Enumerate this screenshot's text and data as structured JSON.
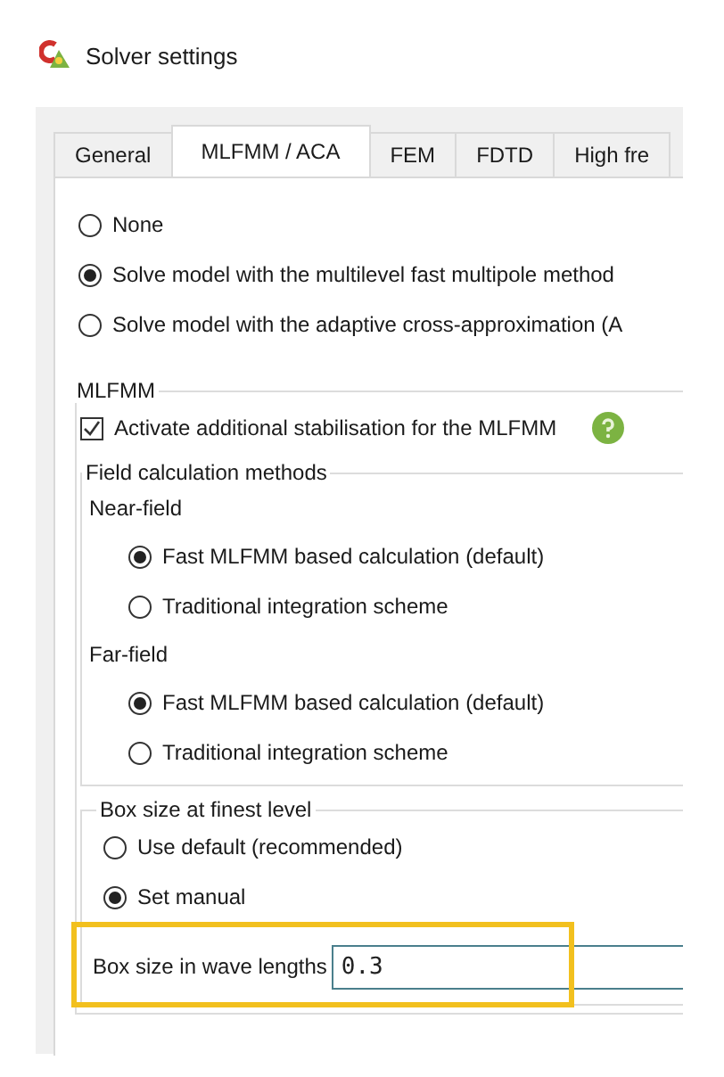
{
  "window": {
    "title": "Solver settings"
  },
  "tabs": [
    {
      "label": "General",
      "selected": false
    },
    {
      "label": "MLFMM / ACA",
      "selected": true
    },
    {
      "label": "FEM",
      "selected": false
    },
    {
      "label": "FDTD",
      "selected": false
    },
    {
      "label": "High fre",
      "selected": false
    }
  ],
  "solver_options": [
    {
      "label": "None",
      "selected": false
    },
    {
      "label": "Solve model with the multilevel fast multipole method",
      "selected": true
    },
    {
      "label": "Solve model with the adaptive cross-approximation (A",
      "selected": false
    }
  ],
  "mlfmm": {
    "title": "MLFMM",
    "stabilisation": {
      "label": "Activate additional stabilisation for the MLFMM",
      "checked": true
    },
    "field_calculation": {
      "title": "Field calculation methods",
      "sections": [
        {
          "label": "Near-field",
          "options": [
            {
              "label": "Fast MLFMM based calculation (default)",
              "selected": true
            },
            {
              "label": "Traditional integration scheme",
              "selected": false
            }
          ]
        },
        {
          "label": "Far-field",
          "options": [
            {
              "label": "Fast MLFMM based calculation (default)",
              "selected": true
            },
            {
              "label": "Traditional integration scheme",
              "selected": false
            }
          ]
        }
      ]
    },
    "box_size": {
      "title": "Box size at finest level",
      "options": [
        {
          "label": "Use default (recommended)",
          "selected": false
        },
        {
          "label": "Set manual",
          "selected": true
        }
      ],
      "field": {
        "label": "Box size in wave lengths",
        "value": "0.3",
        "highlighted": true
      }
    }
  }
}
